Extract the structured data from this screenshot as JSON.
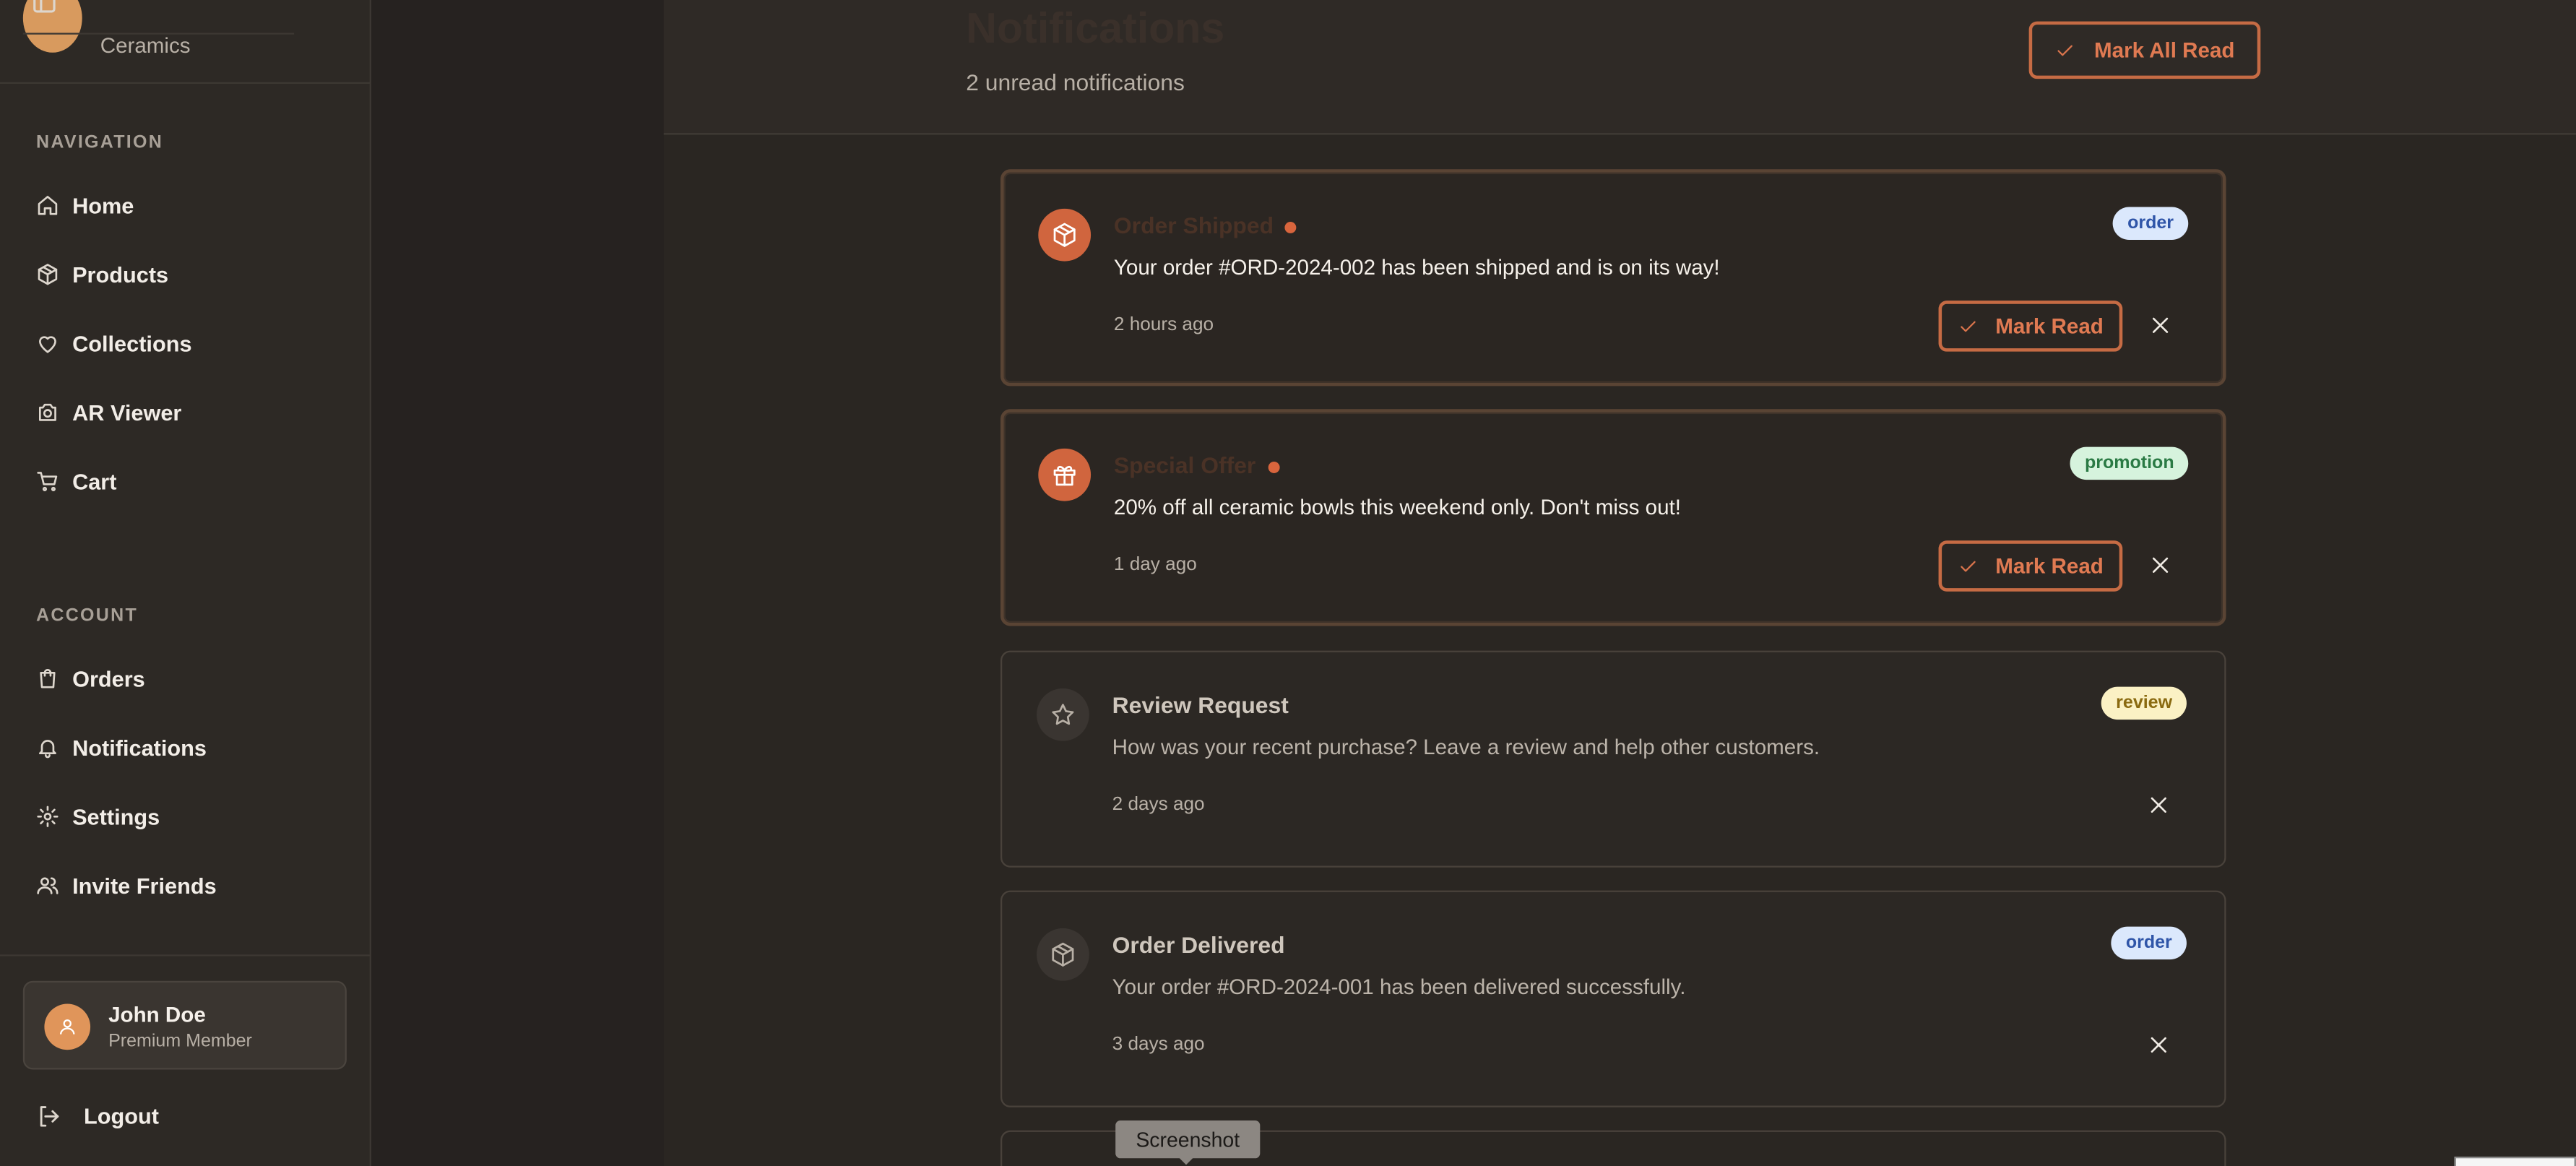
{
  "brand": {
    "name": "Ceramics"
  },
  "sidebar": {
    "navigation_label": "NAVIGATION",
    "nav_items": [
      {
        "label": "Home",
        "icon": "home-icon"
      },
      {
        "label": "Products",
        "icon": "package-icon"
      },
      {
        "label": "Collections",
        "icon": "heart-icon"
      },
      {
        "label": "AR Viewer",
        "icon": "camera-icon"
      },
      {
        "label": "Cart",
        "icon": "cart-icon"
      }
    ],
    "account_label": "ACCOUNT",
    "account_items": [
      {
        "label": "Orders",
        "icon": "shopping-bag-icon"
      },
      {
        "label": "Notifications",
        "icon": "bell-icon"
      },
      {
        "label": "Settings",
        "icon": "gear-icon"
      },
      {
        "label": "Invite Friends",
        "icon": "users-icon"
      }
    ],
    "user": {
      "name": "John Doe",
      "membership": "Premium Member"
    },
    "logout_label": "Logout"
  },
  "header": {
    "title": "Notifications",
    "unread_text": "2 unread notifications",
    "mark_all_label": "Mark All Read"
  },
  "notifications": [
    {
      "title": "Order Shipped",
      "message": "Your order #ORD-2024-002 has been shipped and is on its way!",
      "time": "2 hours ago",
      "badge": "order",
      "unread": true,
      "icon": "package-icon",
      "mark_read_label": "Mark Read"
    },
    {
      "title": "Special Offer",
      "message": "20% off all ceramic bowls this weekend only. Don't miss out!",
      "time": "1 day ago",
      "badge": "promotion",
      "unread": true,
      "icon": "gift-icon",
      "mark_read_label": "Mark Read"
    },
    {
      "title": "Review Request",
      "message": "How was your recent purchase? Leave a review and help other customers.",
      "time": "2 days ago",
      "badge": "review",
      "unread": false,
      "icon": "star-icon"
    },
    {
      "title": "Order Delivered",
      "message": "Your order #ORD-2024-001 has been delivered successfully.",
      "time": "3 days ago",
      "badge": "order",
      "unread": false,
      "icon": "package-icon"
    }
  ],
  "tooltip": {
    "text": "Screenshot"
  },
  "colors": {
    "accent": "#d9653d",
    "sidebar_bg": "#2d2925",
    "content_bg": "#2a2622"
  }
}
